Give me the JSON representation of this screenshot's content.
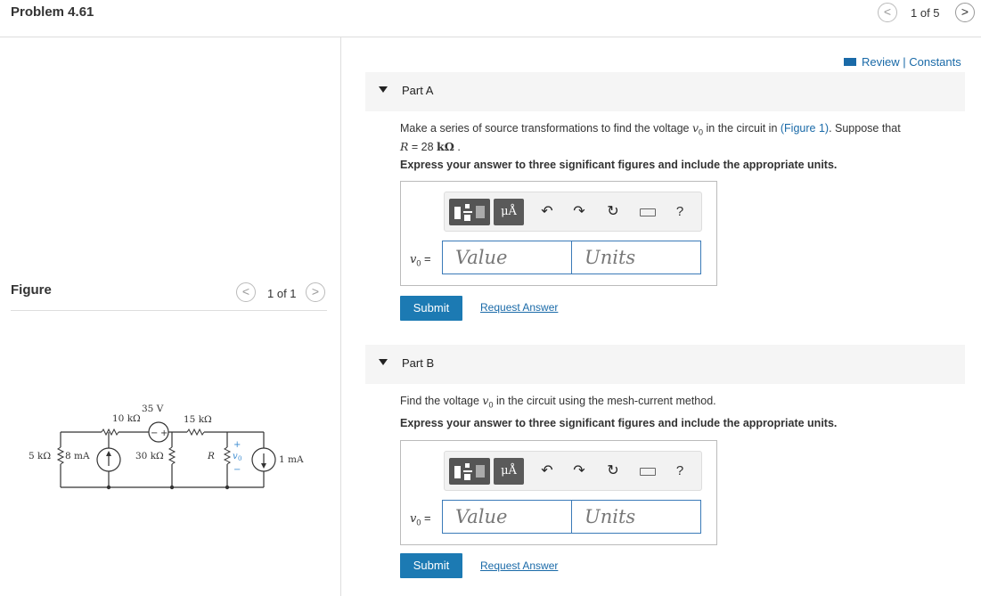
{
  "header": {
    "problem_title": "Problem 4.61",
    "pager_text": "1 of 5",
    "prev_glyph": "<",
    "next_glyph": ">"
  },
  "figure": {
    "title": "Figure",
    "pager_text": "1 of 1",
    "prev_glyph": "<",
    "next_glyph": ">",
    "circuit": {
      "source_35v": "35 V",
      "r_10k": "10 kΩ",
      "r_15k": "15 kΩ",
      "r_5k": "5 kΩ",
      "source_8ma": "8 mA",
      "r_30k": "30 kΩ",
      "r_R": "R",
      "vo_label": "v",
      "vo_sub": "0",
      "plus": "+",
      "minus": "−",
      "source_1ma": "1 mA"
    }
  },
  "right": {
    "review_link": "Review | Constants",
    "part_a": {
      "label": "Part A",
      "q_prefix": "Make a series of source transformations to find the voltage ",
      "q_var": "v",
      "q_var_sub": "0",
      "q_mid": " in the circuit in ",
      "q_link": "(Figure 1)",
      "q_suffix": ". Suppose that",
      "q_r": "R",
      "q_r_value": " = 28 ",
      "q_r_unit": "kΩ",
      "q_end": " .",
      "instruction": "Express your answer to three significant figures and include the appropriate units.",
      "eq_var": "v",
      "eq_sub": "0",
      "eq_equals": " =",
      "value_placeholder": "Value",
      "units_placeholder": "Units",
      "submit": "Submit",
      "request": "Request Answer"
    },
    "part_b": {
      "label": "Part B",
      "q_prefix": "Find the voltage ",
      "q_var": "v",
      "q_var_sub": "0",
      "q_suffix": " in the circuit using the mesh-current method.",
      "instruction": "Express your answer to three significant figures and include the appropriate units.",
      "eq_var": "v",
      "eq_sub": "0",
      "eq_equals": " =",
      "value_placeholder": "Value",
      "units_placeholder": "Units",
      "submit": "Submit",
      "request": "Request Answer"
    },
    "toolbar": {
      "units_button": "μÅ",
      "undo_glyph": "↶",
      "redo_glyph": "↷",
      "reset_glyph": "↻",
      "help_glyph": "?"
    }
  },
  "colors": {
    "accent": "#1c7ab3",
    "link": "#1a6aa8",
    "circuit_blue": "#3a8ad0"
  }
}
